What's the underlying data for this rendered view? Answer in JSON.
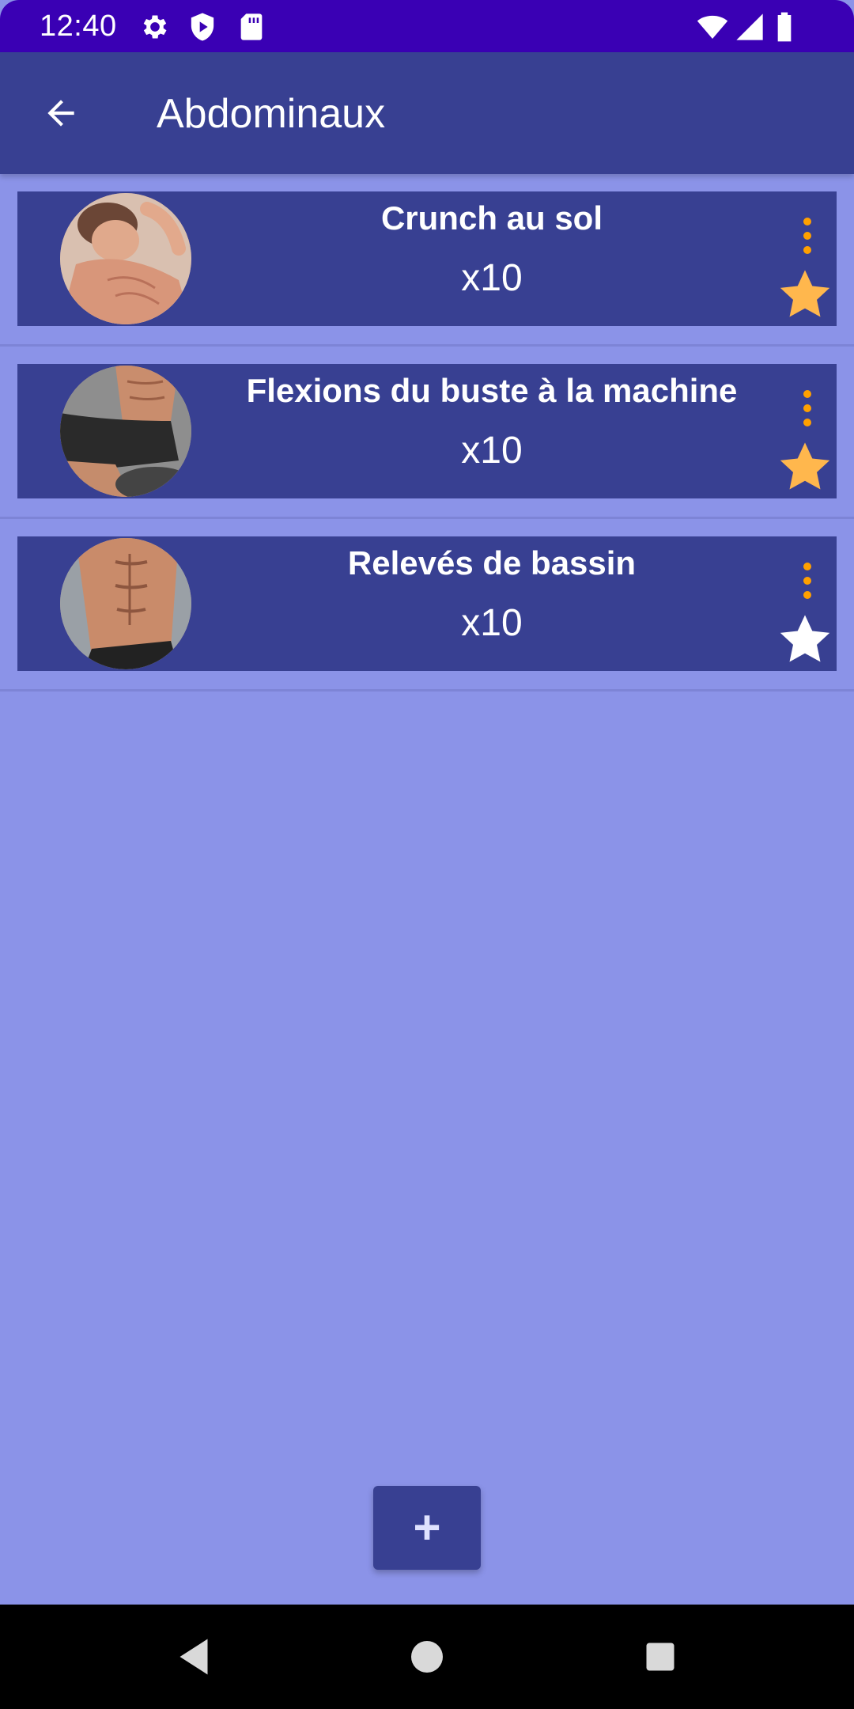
{
  "status_bar": {
    "time": "12:40",
    "icons_left": [
      "settings-icon",
      "play-protect-icon",
      "sd-card-icon"
    ],
    "icons_right": [
      "wifi-icon",
      "signal-icon",
      "battery-icon"
    ]
  },
  "app_bar": {
    "title": "Abdominaux",
    "back_icon": "arrow-back-icon"
  },
  "colors": {
    "status_bar": "#3a00b4",
    "primary": "#384092",
    "background": "#8b93e8",
    "accent": "#ffb74d",
    "menu_dots": "#ffa000"
  },
  "exercises": [
    {
      "name": "Crunch au sol",
      "reps": "x10",
      "favorite": true
    },
    {
      "name": "Flexions du buste à la machine",
      "reps": "x10",
      "favorite": true
    },
    {
      "name": "Relevés de bassin",
      "reps": "x10",
      "favorite": false
    }
  ],
  "add_button": {
    "label": "+"
  },
  "nav_bar": {
    "buttons": [
      "back-icon",
      "home-icon",
      "recents-icon"
    ]
  }
}
